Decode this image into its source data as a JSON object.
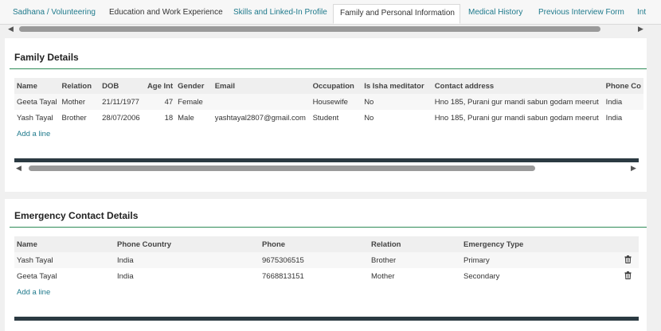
{
  "tabs": [
    {
      "label": "Sadhana / Volunteering"
    },
    {
      "label": "Education and Work Experience"
    },
    {
      "label": "Skills and Linked-In Profile"
    },
    {
      "label": "Family and Personal Information"
    },
    {
      "label": "Medical History"
    },
    {
      "label": "Previous Interview Form"
    },
    {
      "label": "Int"
    }
  ],
  "family": {
    "title": "Family Details",
    "columns": [
      "Name",
      "Relation",
      "DOB",
      "Age Int",
      "Gender",
      "Email",
      "Occupation",
      "Is Isha meditator",
      "Contact address",
      "Phone Co"
    ],
    "rows": [
      [
        "Geeta Tayal",
        "Mother",
        "21/11/1977",
        "47",
        "Female",
        "",
        "Housewife",
        "No",
        "Hno 185, Purani gur mandi sabun godam meerut",
        "India"
      ],
      [
        "Yash Tayal",
        "Brother",
        "28/07/2006",
        "18",
        "Male",
        "yashtayal2807@gmail.com",
        "Student",
        "No",
        "Hno 185, Purani gur mandi sabun godam meerut",
        "India"
      ]
    ],
    "add_line": "Add a line"
  },
  "emergency": {
    "title": "Emergency Contact Details",
    "columns": [
      "Name",
      "Phone Country",
      "Phone",
      "Relation",
      "Emergency Type"
    ],
    "rows": [
      [
        "Yash Tayal",
        "India",
        "9675306515",
        "Brother",
        "Primary"
      ],
      [
        "Geeta Tayal",
        "India",
        "7668813151",
        "Mother",
        "Secondary"
      ]
    ],
    "add_line": "Add a line"
  },
  "icons": {
    "delete": "trash-icon",
    "scroll_left": "triangle-left-icon",
    "scroll_right": "triangle-right-icon"
  },
  "colors": {
    "link": "#1f7a8c",
    "section_rule": "#2e8b57",
    "dark_bar": "#2b3a42"
  }
}
